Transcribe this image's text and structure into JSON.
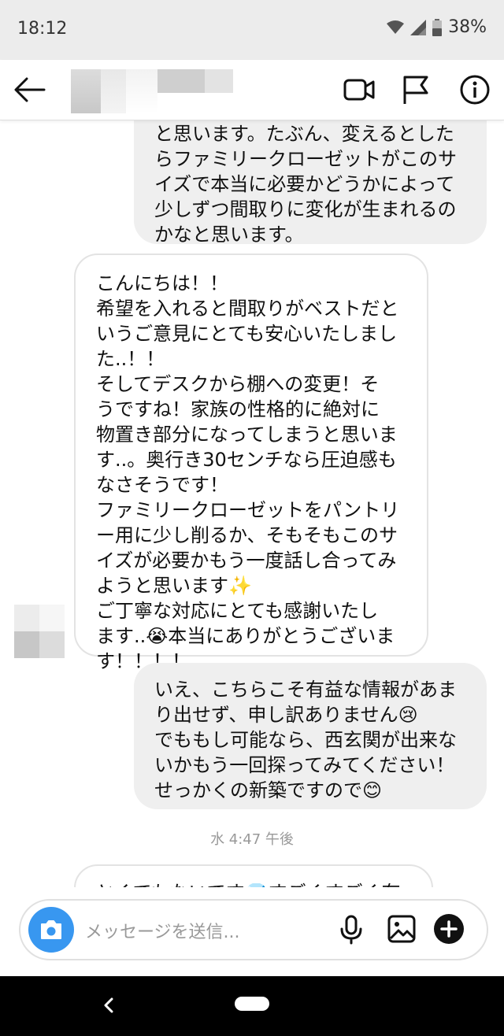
{
  "status": {
    "time": "18:12",
    "battery": "38%"
  },
  "messages": {
    "sent_top": "と思います。たぶん、変えるとした\nらファミリークローゼットがこのサ\nイズで本当に必要かどうかによって\n少しずつ間取りに変化が生まれるの\nかなと思います。",
    "received": "こんにちは！！\n希望を入れると間取りがベストだと\nいうご意見にとても安心いたしまし\nた..！！\nそしてデスクから棚への変更！そ\nうですね！家族の性格的に絶対に\n物置き部分になってしまうと思いま\nす..。奥行き30センチなら圧迫感も\nなさそうです！\nファミリークローゼットをパントリ\nー用に少し削るか、そもそもこのサ\nイズが必要かもう一度話し合ってみ\nようと思います✨\nご丁寧な対応にとても感謝いたし\nます..😭本当にありがとうございま\nす！！！！",
    "sent_reply": "いえ、こちらこそ有益な情報があま\nり出せず、申し訳ありません😢\nでももし可能なら、西玄関が出来な\nいかもう一回探ってみてください！\nせっかくの新築ですので😊",
    "timestamp": "水 4:47 午後",
    "partial_bottom": "とくてもないです💎すごくすごく有"
  },
  "composer": {
    "placeholder": "メッセージを送信..."
  },
  "colors": {
    "accent": "#3897f0",
    "sent_bubble": "#efefef"
  }
}
